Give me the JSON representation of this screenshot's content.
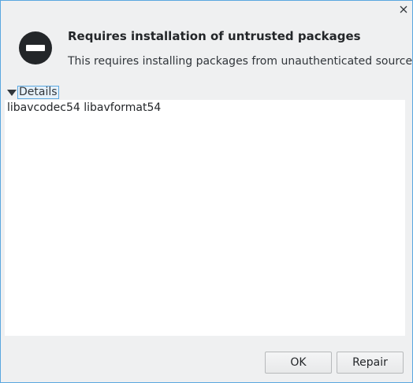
{
  "dialog": {
    "close_icon": "close-icon",
    "status_icon": "forbidden-icon",
    "title": "Requires installation of untrusted packages",
    "message": "This requires installing packages from unauthenticated sources.",
    "details": {
      "toggle_label": "Details",
      "expanded": true,
      "content": "libavcodec54 libavformat54"
    },
    "buttons": {
      "ok_label": "OK",
      "repair_label": "Repair"
    },
    "colors": {
      "accent": "#5aa7e0",
      "background": "#eff0f1",
      "text": "#232629"
    }
  }
}
